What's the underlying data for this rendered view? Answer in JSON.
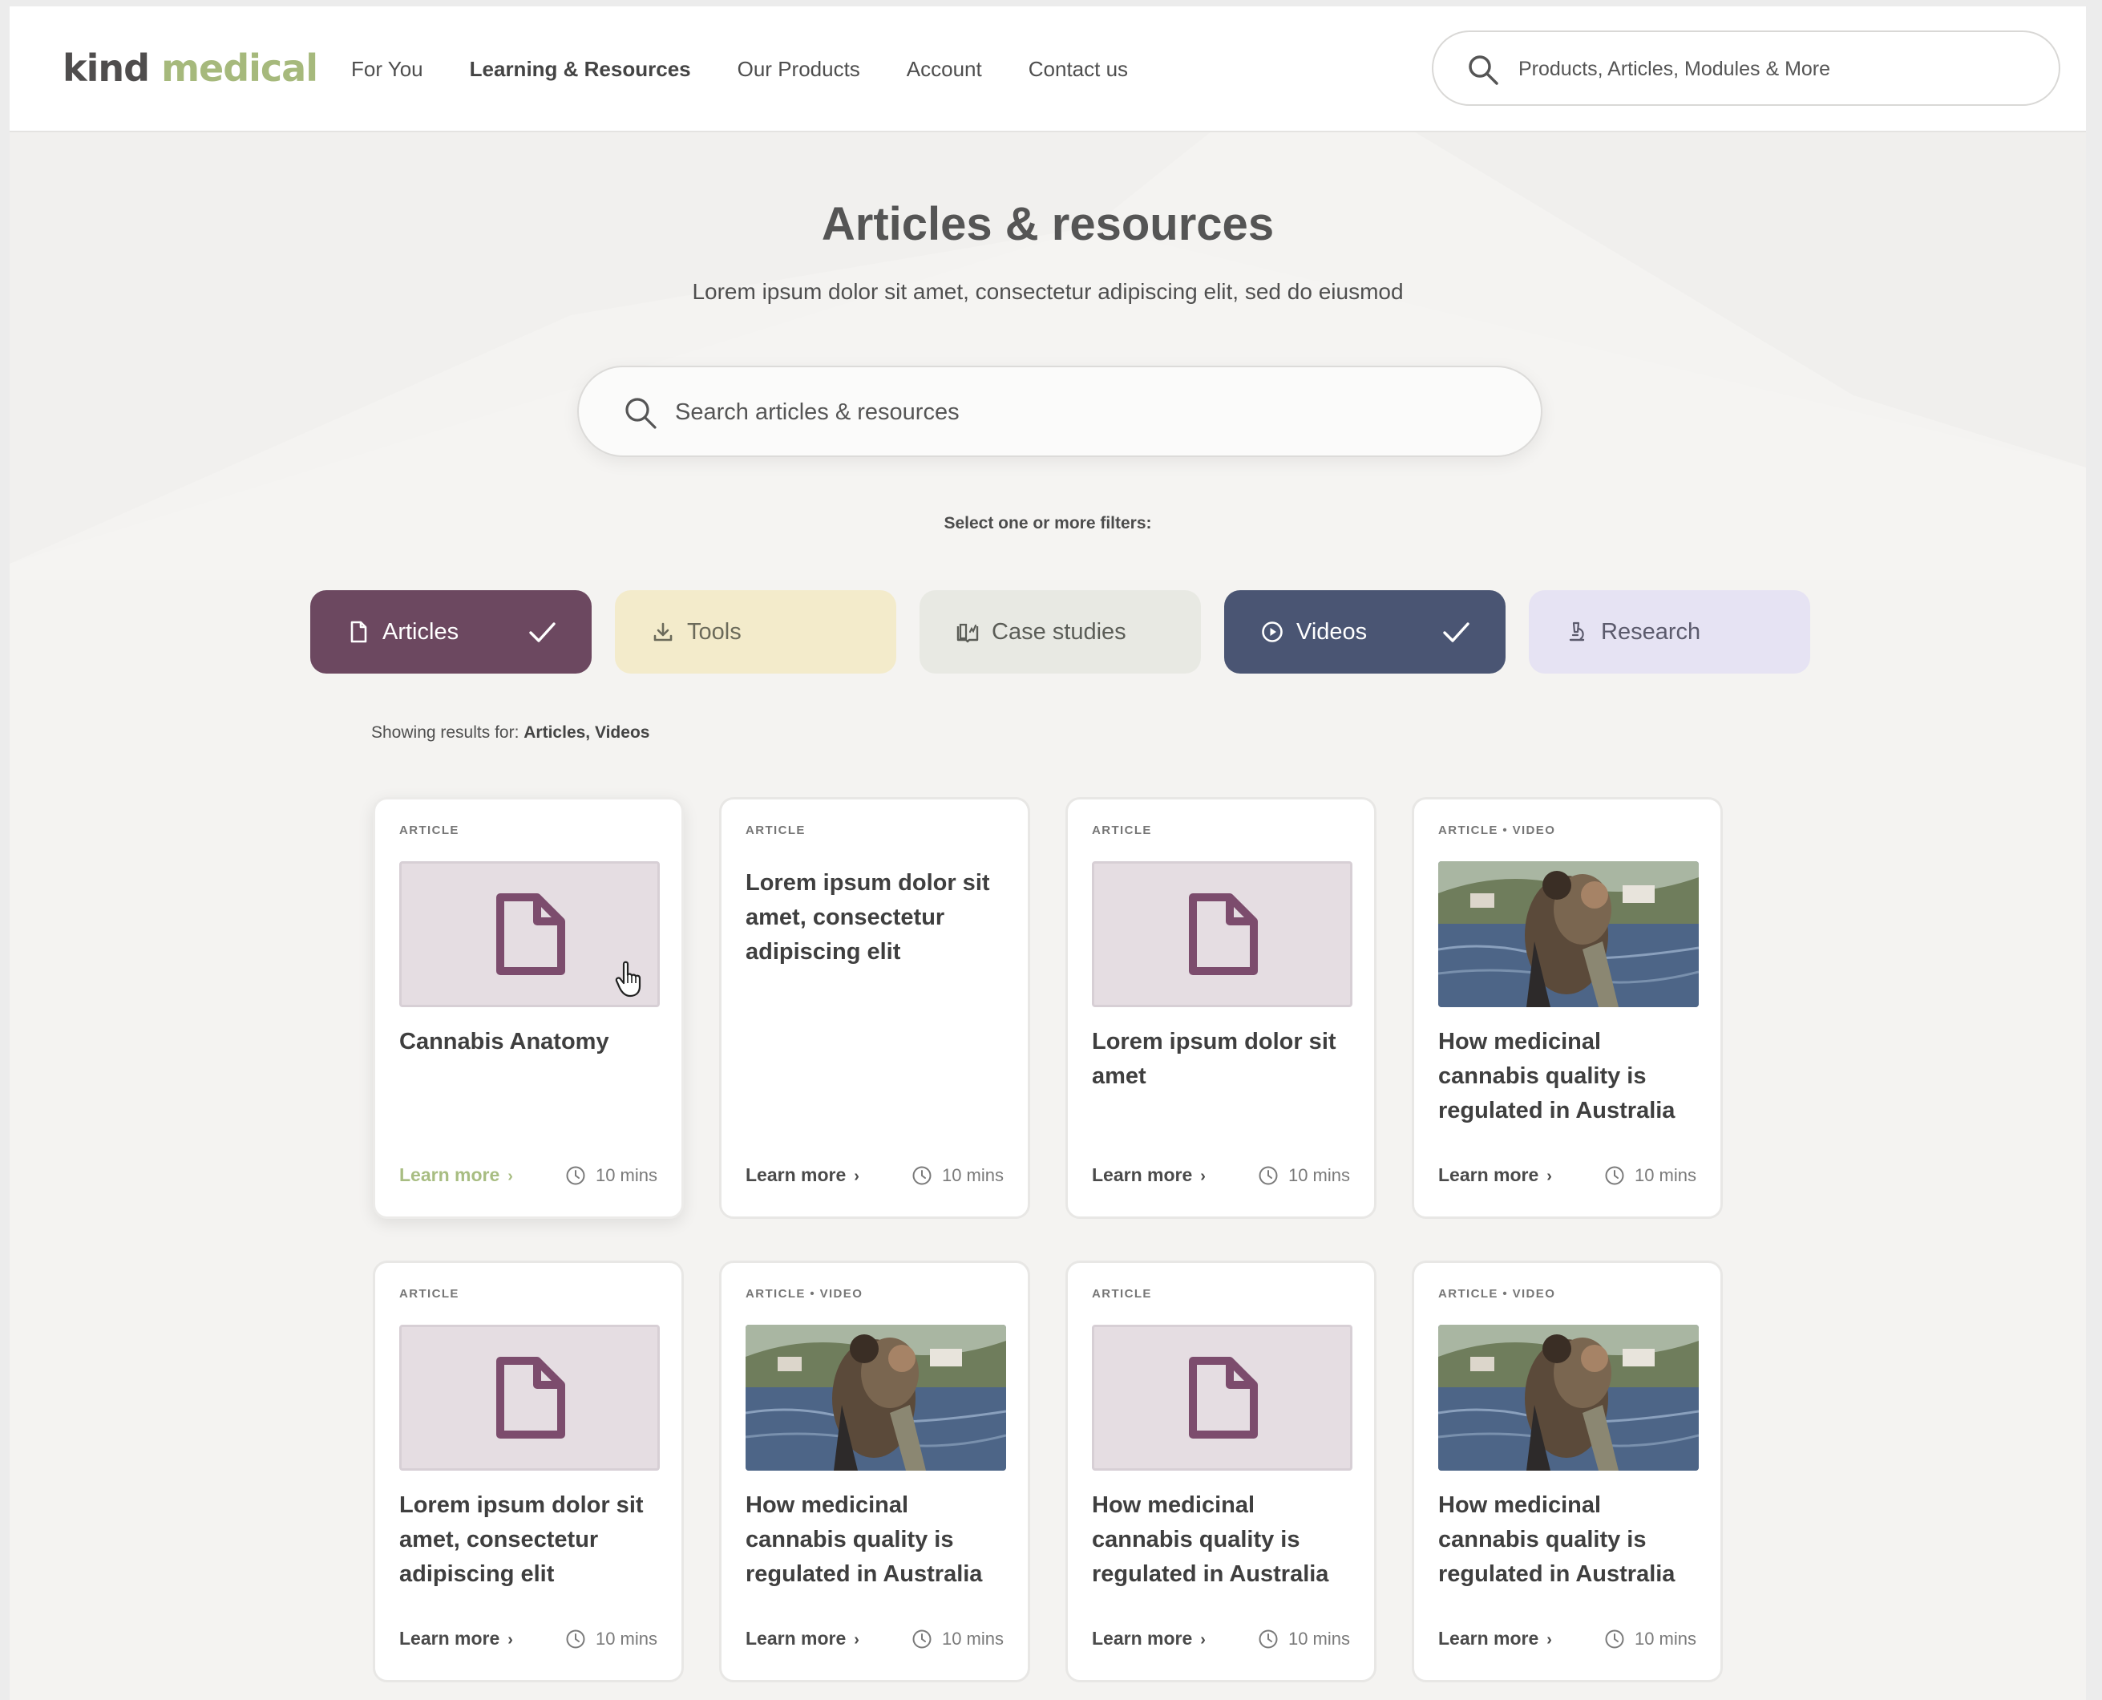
{
  "header": {
    "logo": {
      "part1": "kind",
      "part2": "medical"
    },
    "nav": [
      "For You",
      "Learning & Resources",
      "Our Products",
      "Account",
      "Contact us"
    ],
    "active_nav": "Learning & Resources",
    "search": {
      "placeholder": "Products, Articles, Modules & More",
      "icon": "search-icon"
    }
  },
  "hero": {
    "title": "Articles & resources",
    "subtitle": "Lorem ipsum dolor sit amet, consectetur adipiscing elit, sed do eiusmod",
    "search": {
      "placeholder": "Search articles & resources",
      "icon": "search-icon"
    },
    "filter_prompt": "Select one or more filters:"
  },
  "filters": [
    {
      "label": "Articles",
      "icon": "document-icon",
      "selected": true,
      "color": "#6c4860"
    },
    {
      "label": "Tools",
      "icon": "download-icon",
      "selected": false,
      "color": "#f3ebcb"
    },
    {
      "label": "Case studies",
      "icon": "book-icon",
      "selected": false,
      "color": "#e8e9e3"
    },
    {
      "label": "Videos",
      "icon": "play-icon",
      "selected": true,
      "color": "#4a5573"
    },
    {
      "label": "Research",
      "icon": "microscope-icon",
      "selected": false,
      "color": "#e6e3f3"
    }
  ],
  "results": {
    "prefix": "Showing results for:",
    "values": "Articles, Videos"
  },
  "cards": [
    {
      "tag": "ARTICLE",
      "thumb": "document",
      "title": "Cannabis Anatomy",
      "link": "Learn more",
      "duration": "10 mins"
    },
    {
      "tag": "ARTICLE",
      "thumb": "none",
      "title": "Lorem ipsum dolor sit amet, consectetur adipiscing elit",
      "link": "Learn more",
      "duration": "10 mins"
    },
    {
      "tag": "ARTICLE",
      "thumb": "document",
      "title": "Lorem ipsum dolor sit amet",
      "link": "Learn more",
      "duration": "10 mins"
    },
    {
      "tag": "ARTICLE • VIDEO",
      "thumb": "photo",
      "title": "How medicinal cannabis quality is regulated in Australia",
      "link": "Learn more",
      "duration": "10 mins"
    },
    {
      "tag": "ARTICLE",
      "thumb": "document",
      "title": "Lorem ipsum dolor sit amet, consectetur adipiscing elit",
      "link": "Learn more",
      "duration": "10 mins"
    },
    {
      "tag": "ARTICLE • VIDEO",
      "thumb": "photo",
      "title": "How medicinal cannabis quality is regulated in Australia",
      "link": "Learn more",
      "duration": "10 mins"
    },
    {
      "tag": "ARTICLE",
      "thumb": "document",
      "title": "How medicinal cannabis quality is regulated in Australia",
      "link": "Learn more",
      "duration": "10 mins"
    },
    {
      "tag": "ARTICLE • VIDEO",
      "thumb": "photo",
      "title": "How medicinal cannabis quality is regulated in Australia",
      "link": "Learn more",
      "duration": "10 mins"
    }
  ],
  "colors": {
    "brand_green": "#a6b97c",
    "brand_plum": "#6c4860",
    "navy": "#4a5573"
  }
}
